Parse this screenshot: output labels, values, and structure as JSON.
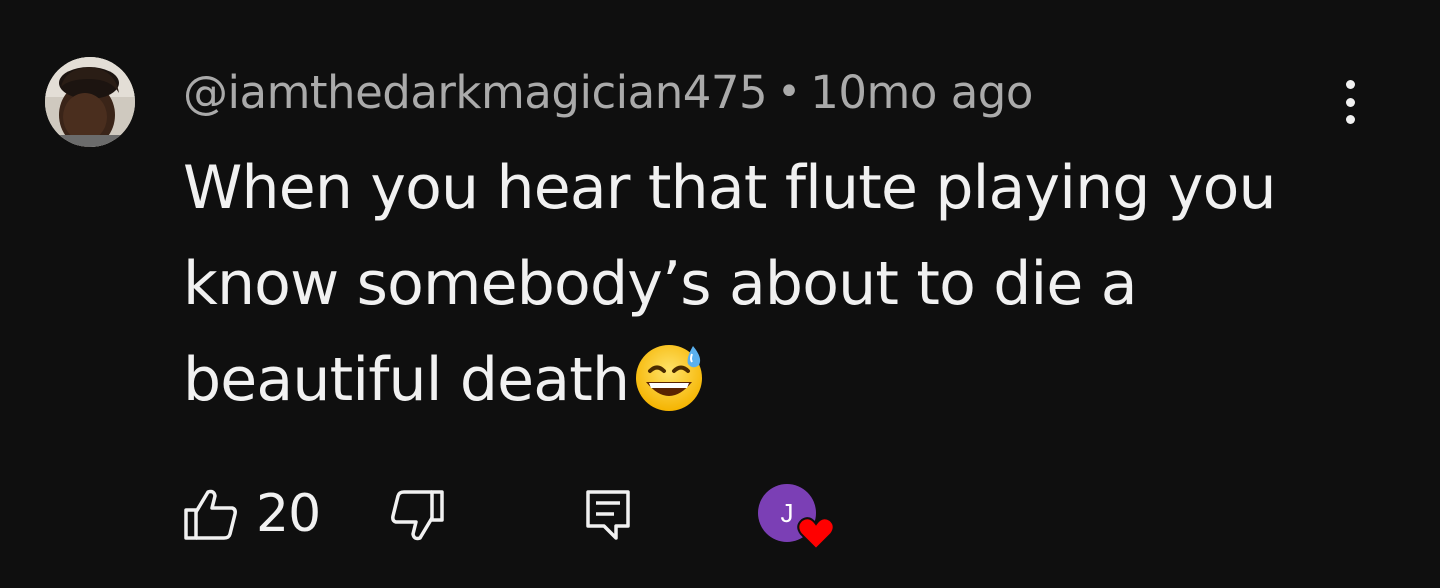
{
  "comment": {
    "author": "@iamthedarkmagician475",
    "separator": "•",
    "timestamp": "10mo ago",
    "text": "When you hear that flute playing you know somebody’s about to die a beautiful death",
    "emoji": "sweat-smile-emoji",
    "like_count": "20",
    "creator_heart_initial": "J"
  },
  "icons": {
    "more": "more-vertical-icon",
    "like": "thumbs-up-icon",
    "dislike": "thumbs-down-icon",
    "reply": "reply-icon",
    "heart": "heart-icon"
  },
  "colors": {
    "background": "#0f0f0f",
    "primary_text": "#f1f1f1",
    "secondary_text": "#aaaaaa",
    "creator_avatar": "#7b3fb5",
    "heart": "#ff0000"
  }
}
